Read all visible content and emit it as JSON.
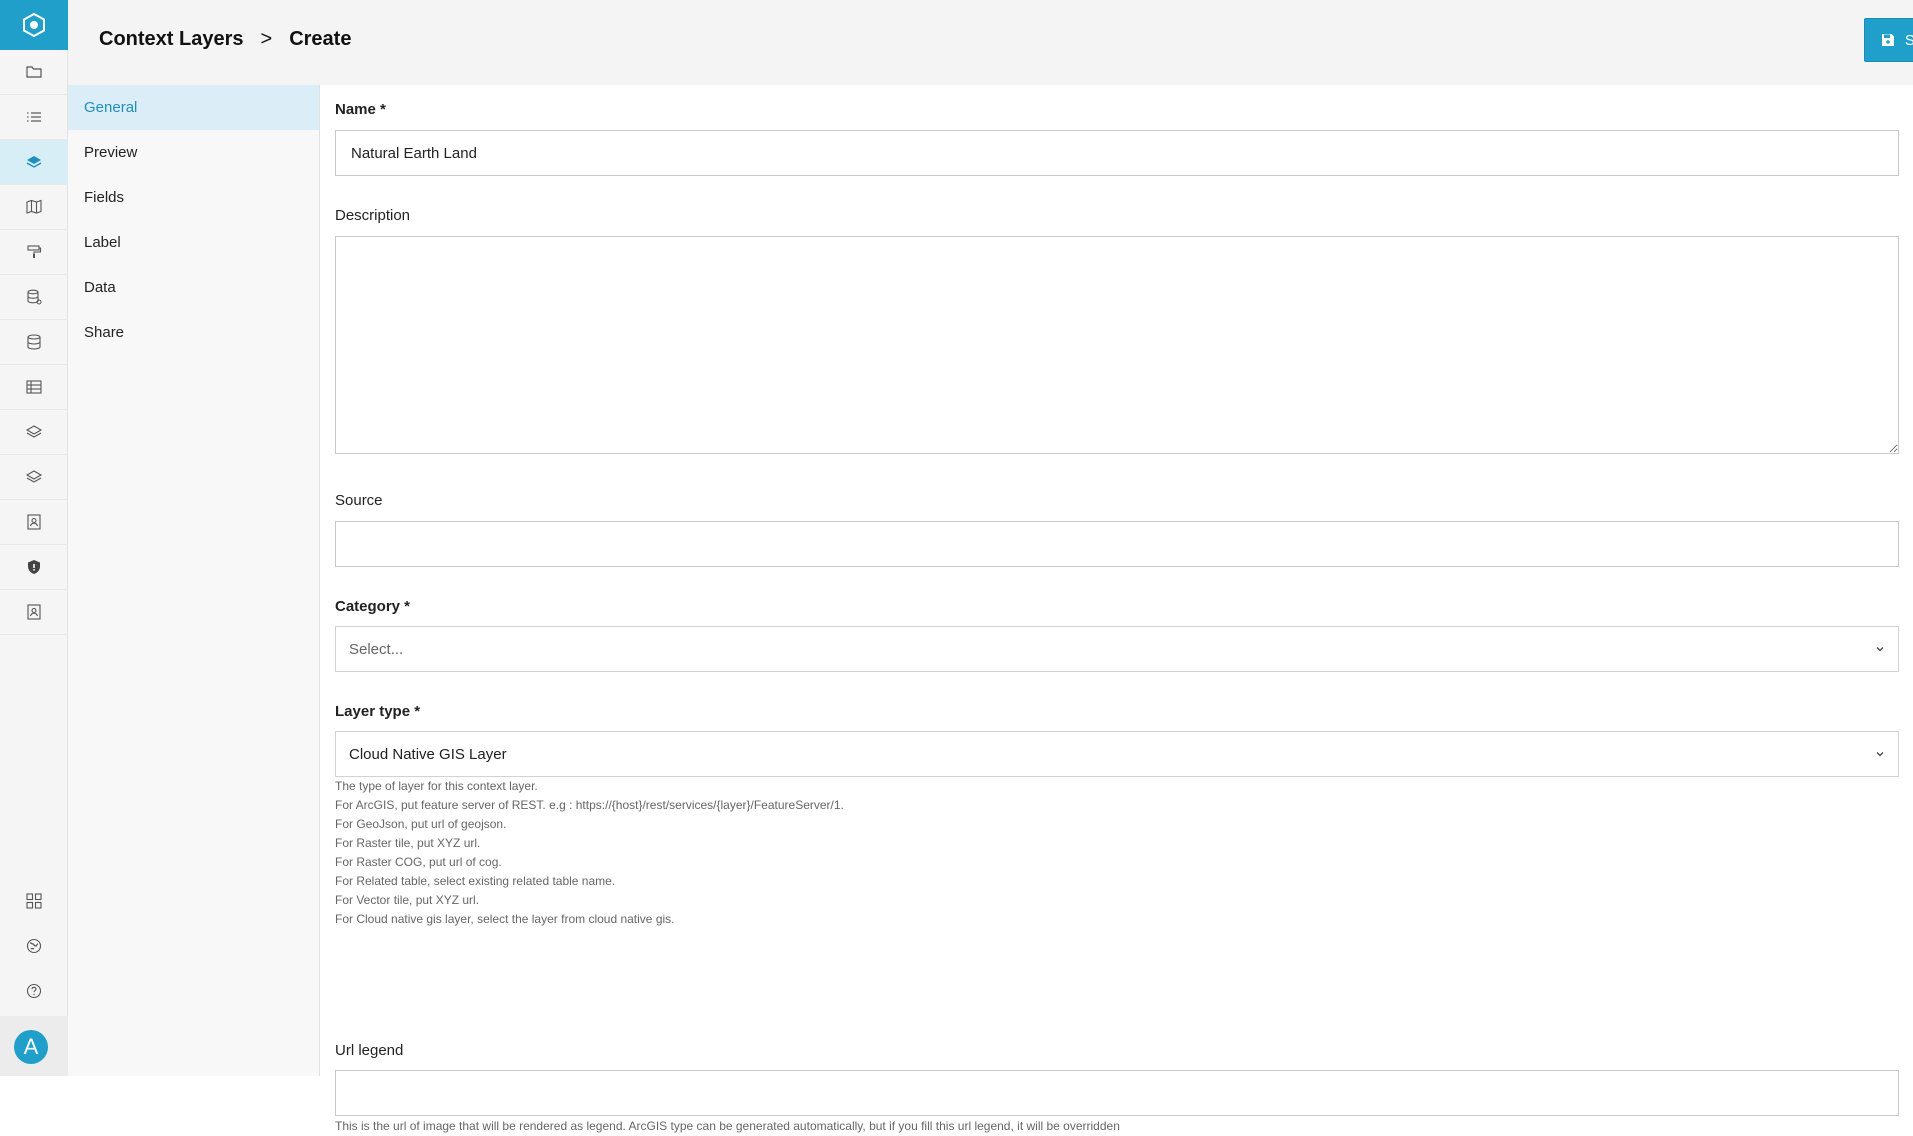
{
  "header": {
    "breadcrumb_root": "Context Layers",
    "breadcrumb_sep": ">",
    "breadcrumb_current": "Create",
    "save_label": "Save"
  },
  "sidebar": {
    "avatar_letter": "A",
    "accent_color": "#1f9fc9",
    "icons": [
      "folder-icon",
      "list-icon",
      "layers-icon",
      "map-icon",
      "paint-roller-icon",
      "database-stack-icon",
      "database-icon",
      "table-icon",
      "layers-outline-icon",
      "layers-outline-icon",
      "contact-book-icon",
      "shield-icon",
      "contact-book-icon",
      "grid-icon",
      "globe-icon",
      "help-icon"
    ]
  },
  "subnav": {
    "items": [
      {
        "label": "General"
      },
      {
        "label": "Preview"
      },
      {
        "label": "Fields"
      },
      {
        "label": "Label"
      },
      {
        "label": "Data"
      },
      {
        "label": "Share"
      }
    ]
  },
  "form": {
    "name": {
      "label": "Name *",
      "value": "Natural Earth Land"
    },
    "description": {
      "label": "Description",
      "value": ""
    },
    "source": {
      "label": "Source",
      "value": ""
    },
    "category": {
      "label": "Category *",
      "placeholder": "Select..."
    },
    "layer_type": {
      "label": "Layer type *",
      "value": "Cloud Native GIS Layer",
      "help": [
        "The type of layer for this context layer.",
        "For ArcGIS, put feature server of REST. e.g : https://{host}/rest/services/{layer}/FeatureServer/1.",
        "For GeoJson, put url of geojson.",
        "For Raster tile, put XYZ url.",
        "For Raster COG, put url of cog.",
        "For Related table, select existing related table name.",
        "For Vector tile, put XYZ url.",
        "For Cloud native gis layer, select the layer from cloud native gis."
      ]
    },
    "url_legend": {
      "label": "Url legend",
      "value": "",
      "help": "This is the url of image that will be rendered as legend. ArcGIS type can be generated automatically, but if you fill this url legend, it will be overridden"
    }
  }
}
